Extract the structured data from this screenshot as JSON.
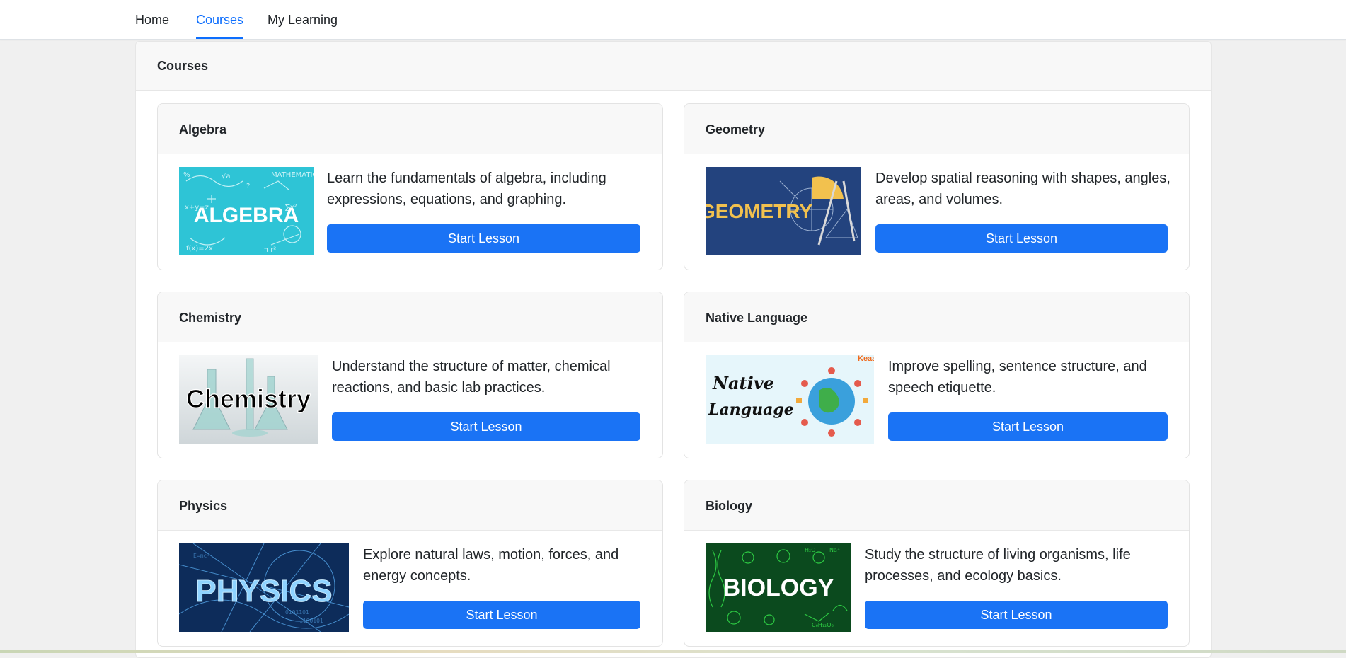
{
  "nav": {
    "tabs": [
      {
        "label": "Home",
        "active": false
      },
      {
        "label": "Courses",
        "active": true
      },
      {
        "label": "My Learning",
        "active": false
      }
    ]
  },
  "colors": {
    "accent": "#0d6efd",
    "button": "#1a73f5",
    "page_background": "#f0f0f0",
    "card_header": "#f8f8f8"
  },
  "panel": {
    "title": "Courses"
  },
  "courses": [
    {
      "title": "Algebra",
      "description": "Learn the fundamentals of algebra, including expressions, equations, and graphing.",
      "button_label": "Start Lesson",
      "image_text": "ALGEBRA"
    },
    {
      "title": "Geometry",
      "description": "Develop spatial reasoning with shapes, angles, areas, and volumes.",
      "button_label": "Start Lesson",
      "image_text": "GEOMETRY"
    },
    {
      "title": "Chemistry",
      "description": "Understand the structure of matter, chemical reactions, and basic lab practices.",
      "button_label": "Start Lesson",
      "image_text": "Chemistry"
    },
    {
      "title": "Native Language",
      "description": "Improve spelling, sentence structure, and speech etiquette.",
      "button_label": "Start Lesson",
      "image_text": "Native Language"
    },
    {
      "title": "Physics",
      "description": "Explore natural laws, motion, forces, and energy concepts.",
      "button_label": "Start Lesson",
      "image_text": "PHYSICS"
    },
    {
      "title": "Biology",
      "description": "Study the structure of living organisms, life processes, and ecology basics.",
      "button_label": "Start Lesson",
      "image_text": "BIOLOGY"
    }
  ]
}
